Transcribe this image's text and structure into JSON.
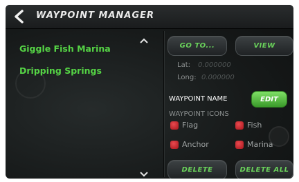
{
  "header": {
    "title": "WAYPOINT MANAGER",
    "back_icon": "chevron-left-icon"
  },
  "waypoints": [
    {
      "label": "Giggle Fish Marina"
    },
    {
      "label": "Dripping Springs"
    }
  ],
  "scroll": {
    "up_icon": "chevron-up-icon",
    "down_icon": "chevron-down-icon"
  },
  "actions": {
    "goto_label": "GO TO...",
    "view_label": "VIEW",
    "delete_label": "DELETE",
    "delete_all_label": "DELETE ALL"
  },
  "coords": {
    "lat_label": "Lat:",
    "lat_value": "0.000000",
    "long_label": "Long:",
    "long_value": "0.000000"
  },
  "name_section": {
    "label": "WAYPOINT NAME",
    "edit_label": "EDIT"
  },
  "icons_section": {
    "label": "WAYPOINT ICONS",
    "options": [
      {
        "label": "Flag"
      },
      {
        "label": "Fish"
      },
      {
        "label": "Anchor"
      },
      {
        "label": "Marina"
      }
    ]
  },
  "colors": {
    "accent_green": "#55d445",
    "edit_green": "#5cc545",
    "checkbox_red": "#d0252c",
    "background": "#171a1a"
  }
}
